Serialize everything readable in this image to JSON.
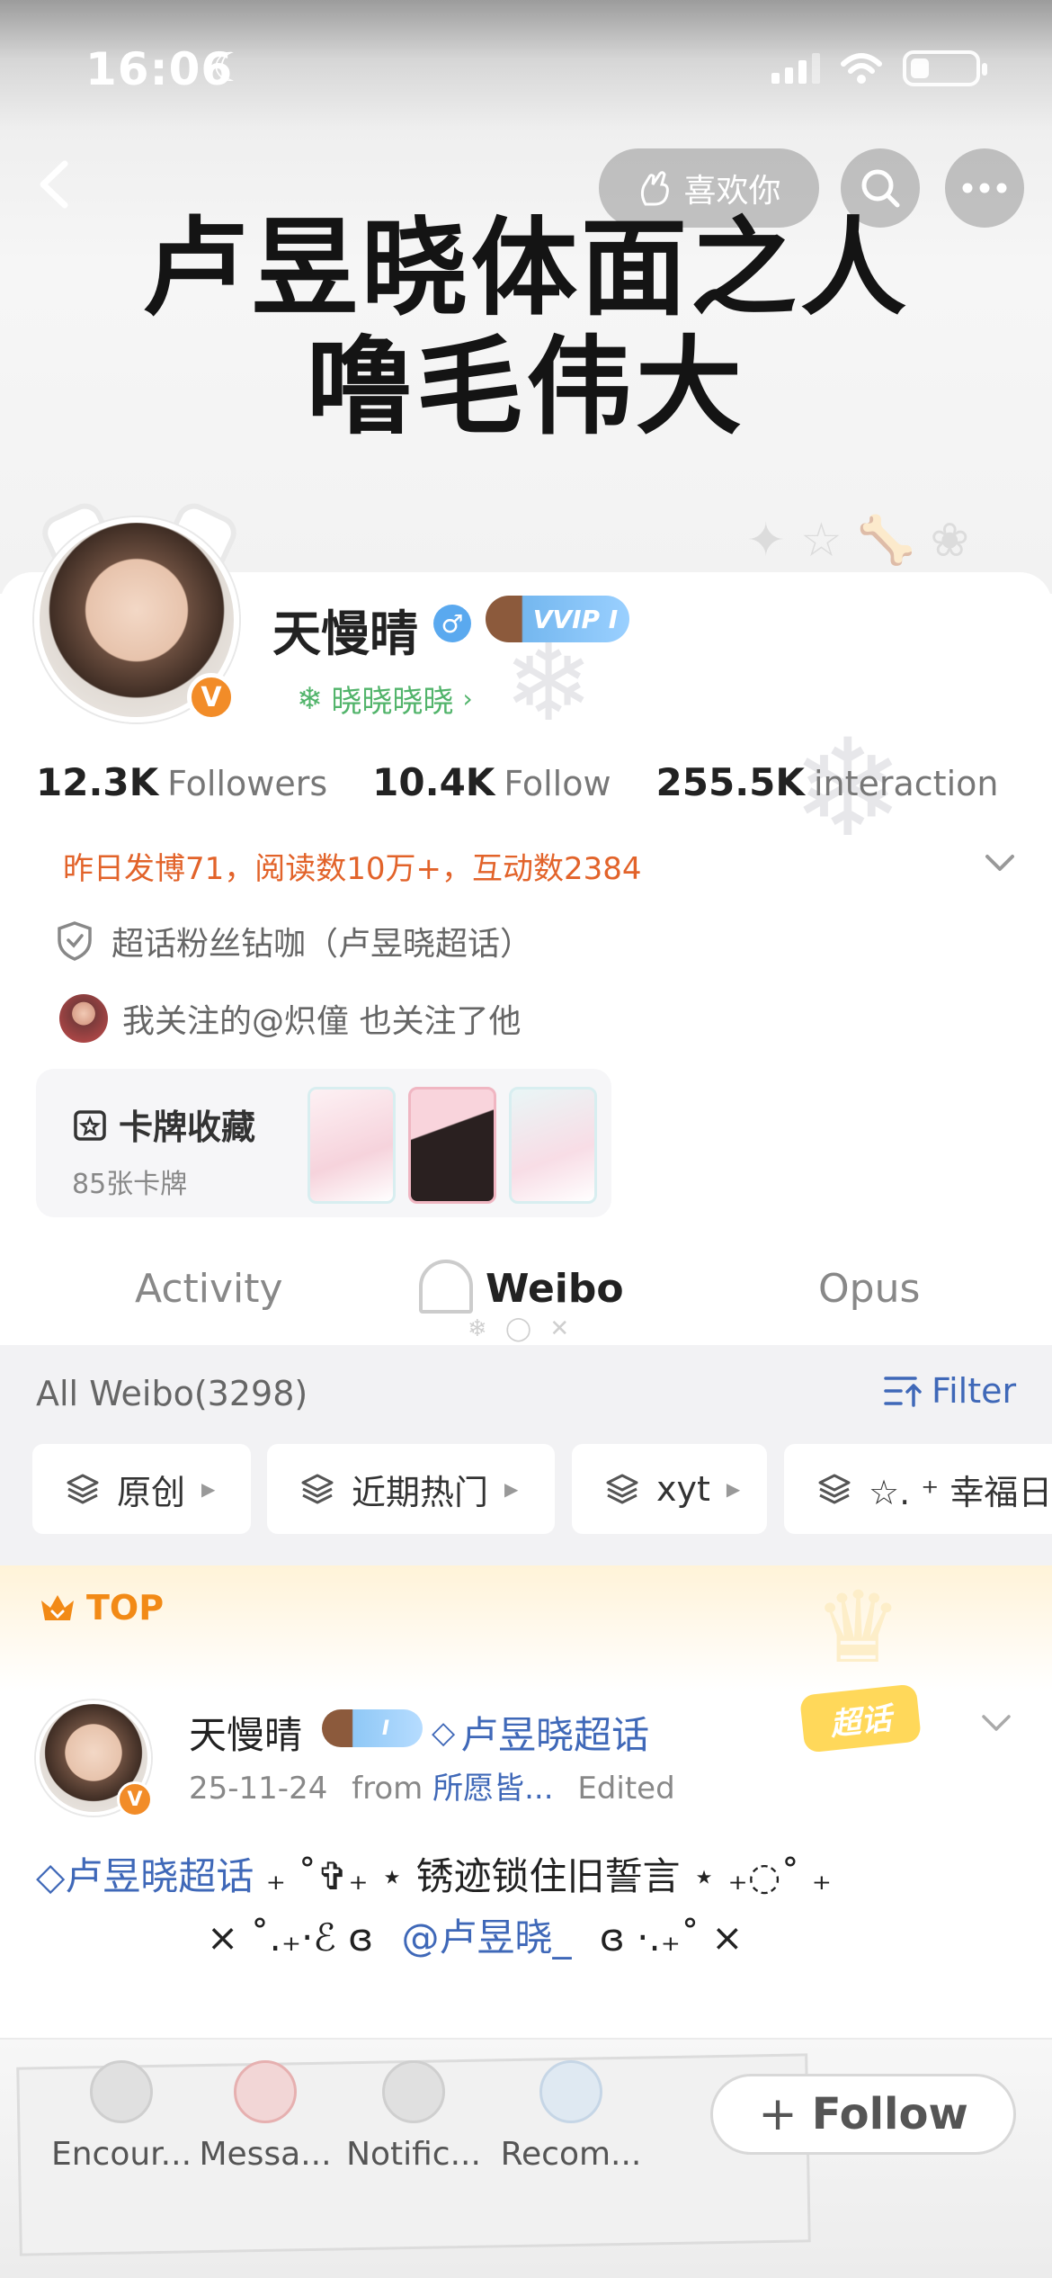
{
  "status_bar": {
    "time": "16:06",
    "moon_icon": "moon-icon",
    "signal_bars": 3,
    "battery_level_fraction": 0.25
  },
  "header": {
    "like_button_label": "喜欢你",
    "banner_title_line1": "卢昱晓体面之人",
    "banner_title_line2": "噜毛伟大"
  },
  "profile": {
    "username": "天慢晴",
    "gender_symbol": "♂",
    "vip_label": "VVIP I",
    "verified_badge": "V",
    "group_link_label": "晓晓晓晓",
    "stats": [
      {
        "value": "12.3K",
        "label": "Followers"
      },
      {
        "value": "10.4K",
        "label": "Follow"
      },
      {
        "value": "255.5K",
        "label": "interaction"
      }
    ],
    "activity_summary": "昨日发博71，阅读数10万+，互动数2384",
    "fan_tag": "超话粉丝钻咖（卢昱晓超话）",
    "mutual_follow": "我关注的@炽僮 也关注了他",
    "card_collection": {
      "title": "卡牌收藏",
      "count": "85张卡牌"
    }
  },
  "tabs": [
    {
      "label": "Activity",
      "active": false
    },
    {
      "label": "Weibo",
      "active": true
    },
    {
      "label": "Opus",
      "active": false
    }
  ],
  "feed": {
    "all_weibo_label": "All Weibo(3298)",
    "filter_label": "Filter",
    "chips": [
      "原创",
      "近期热门",
      "xyt",
      "☆. ⁺ 幸福日"
    ],
    "top_label": "TOP"
  },
  "post": {
    "author": "天慢晴",
    "vip_label": "I",
    "topic": "卢昱晓超话",
    "chaohua_badge": "超话",
    "date": "25-11-24",
    "from_prefix": "from",
    "source": "所愿皆...",
    "edited": "Edited",
    "line1_topic": "卢昱晓超话",
    "line1_text": "₊ ˚✞₊ ⋆ 锈迹锁住旧誓言 ⋆ ₊◌˚ ₊",
    "line2_prefix": "⨯ ˚.₊·ℰ ɞ",
    "line2_mention": "@卢昱晓_",
    "line2_suffix": "ɞ ·.₊˚ ⨯"
  },
  "bottom_bar": {
    "items": [
      "Encour...",
      "Messa...",
      "Notific...",
      "Recom..."
    ],
    "follow_label": "Follow"
  },
  "colors": {
    "accent_orange": "#e2632a",
    "link_blue": "#3f68b8",
    "green": "#52b46b",
    "top_orange": "#f28a16"
  }
}
